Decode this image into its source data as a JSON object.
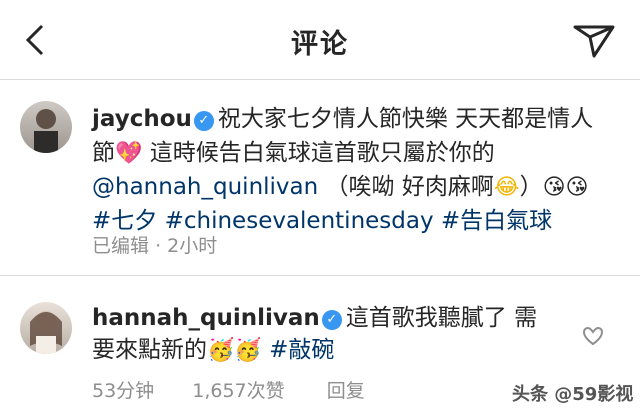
{
  "header": {
    "title": "评论",
    "back_icon": "chevron-left-icon",
    "send_icon": "send-icon"
  },
  "post": {
    "username": "jaychou",
    "verified": true,
    "line1": "祝大家七夕情人節快樂 天天都是情人",
    "line2_a": "節",
    "line2_emoji": "💖",
    "line2_b": " 這時候告白氣球這首歌只屬於你的",
    "line3_mention": "@hannah_quinlivan",
    "line3_text": " （唉呦 好肉麻啊",
    "line3_emoji1": "😂",
    "line3_close": "）",
    "line3_emoji2": "😘😘",
    "hashtags": [
      "#七夕",
      "#chinesevalentinesday",
      "#告白氣球"
    ],
    "edited": "已编辑",
    "dot": "·",
    "time": "2小时"
  },
  "reply": {
    "username": "hannah_quinlivan",
    "verified": true,
    "line1": "這首歌我聽膩了 需",
    "line2_a": "要來點新的",
    "line2_emoji": "🥳🥳",
    "line2_hashtag": "#敲碗",
    "time": "53分钟",
    "likes": "1,657次赞",
    "reply_label": "回复"
  },
  "watermark": "头条 @59影视",
  "colors": {
    "link": "#003569",
    "verified": "#3897f0",
    "meta": "#8e8e8e"
  }
}
